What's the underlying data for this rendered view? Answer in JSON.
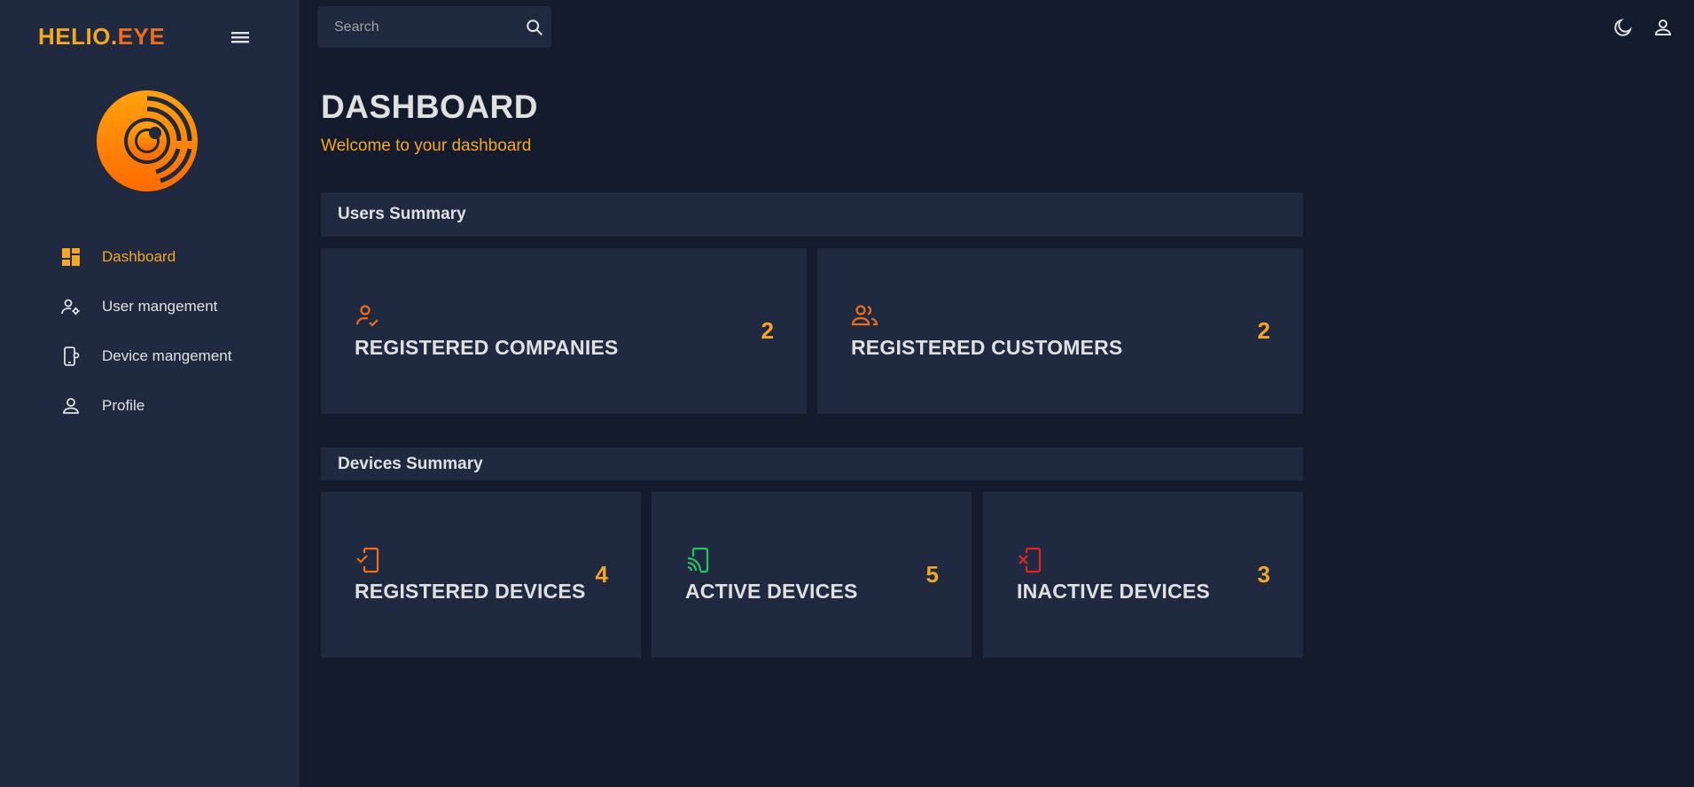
{
  "brand": {
    "part1": "HELIO.",
    "part2": "EYE"
  },
  "colors": {
    "accent": "#f5a623",
    "orange": "#ef6c1a",
    "green": "#22c55e",
    "red": "#e02424",
    "panel": "#1f2a40",
    "bg": "#141b2d"
  },
  "nav": {
    "items": [
      {
        "label": "Dashboard",
        "icon": "dashboard-icon",
        "active": true
      },
      {
        "label": "User mangement",
        "icon": "user-settings-icon"
      },
      {
        "label": "Device mangement",
        "icon": "device-settings-icon"
      },
      {
        "label": "Profile",
        "icon": "person-icon"
      }
    ]
  },
  "search": {
    "placeholder": "Search"
  },
  "header": {
    "title": "DASHBOARD",
    "subtitle": "Welcome to your dashboard"
  },
  "users_summary": {
    "title": "Users Summary",
    "cards": [
      {
        "label": "REGISTERED COMPANIES",
        "value": "2",
        "icon": "person-check-icon"
      },
      {
        "label": "REGISTERED CUSTOMERS",
        "value": "2",
        "icon": "people-icon"
      }
    ]
  },
  "devices_summary": {
    "title": "Devices Summary",
    "cards": [
      {
        "label": "REGISTERED DEVICES",
        "value": "4",
        "icon": "device-check-icon"
      },
      {
        "label": "ACTIVE DEVICES",
        "value": "5",
        "icon": "device-cast-icon"
      },
      {
        "label": "INACTIVE DEVICES",
        "value": "3",
        "icon": "device-x-icon"
      }
    ]
  }
}
